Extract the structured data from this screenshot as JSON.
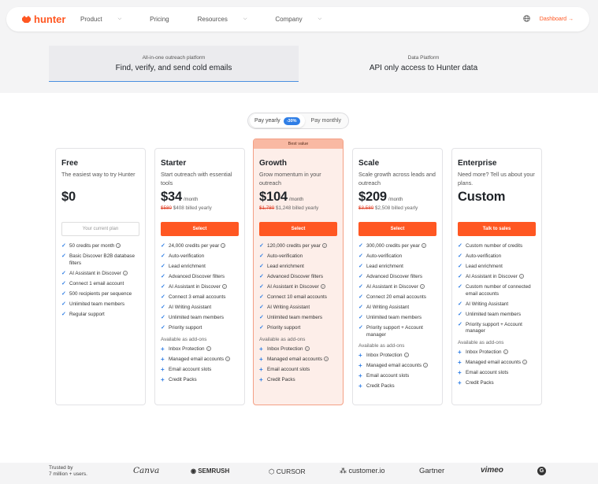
{
  "nav": {
    "brand": "hunter",
    "menu": [
      {
        "label": "Product",
        "chevron": true
      },
      {
        "label": "Pricing",
        "chevron": false
      },
      {
        "label": "Resources",
        "chevron": true
      },
      {
        "label": "Company",
        "chevron": true
      }
    ],
    "dashboard_label": "Dashboard →",
    "icons": [
      "hunter-logo-icon",
      "globe-icon"
    ],
    "accent_color": "#ff5722"
  },
  "tabs": [
    {
      "sub": "All-in-one outreach platform",
      "main": "Find, verify, and send cold emails",
      "active": true
    },
    {
      "sub": "Data Platform",
      "main": "API only access to Hunter data",
      "active": false
    }
  ],
  "billing_toggle": {
    "yearly_label": "Pay yearly",
    "discount_badge": "-30%",
    "monthly_label": "Pay monthly",
    "selected": "yearly",
    "badge_color": "#2f7ee6"
  },
  "plans": [
    {
      "name": "Free",
      "desc": "The easiest way to try Hunter",
      "price": "$0",
      "per": "",
      "old_price": "",
      "billed": "",
      "button": "Your current plan",
      "button_style": "ghost",
      "features": [
        {
          "text": "50 credits per month",
          "info": true
        },
        {
          "text": "Basic Discover B2B database filters",
          "info": false
        },
        {
          "text": "AI Assistant in Discover",
          "info": true
        },
        {
          "text": "Connect 1 email account",
          "info": false
        },
        {
          "text": "500 recipients per sequence",
          "info": false
        },
        {
          "text": "Unlimited team members",
          "info": false
        },
        {
          "text": "Regular support",
          "info": false
        }
      ],
      "addons_heading": "",
      "addons": []
    },
    {
      "name": "Starter",
      "desc": "Start outreach with essential tools",
      "price": "$34",
      "per": "/month",
      "old_price": "$580",
      "billed": "$408 billed yearly",
      "button": "Select",
      "button_style": "primary",
      "features": [
        {
          "text": "24,000 credits per year",
          "info": true
        },
        {
          "text": "Auto-verification",
          "info": false
        },
        {
          "text": "Lead enrichment",
          "info": false
        },
        {
          "text": "Advanced Discover filters",
          "info": false
        },
        {
          "text": "AI Assistant in Discover",
          "info": true
        },
        {
          "text": "Connect 3 email accounts",
          "info": false
        },
        {
          "text": "AI Writing Assistant",
          "info": false
        },
        {
          "text": "Unlimited team members",
          "info": false
        },
        {
          "text": "Priority support",
          "info": false
        }
      ],
      "addons_heading": "Available as add-ons",
      "addons": [
        {
          "text": "Inbox Protection",
          "info": true
        },
        {
          "text": "Managed email accounts",
          "info": true
        },
        {
          "text": "Email account slots",
          "info": false
        },
        {
          "text": "Credit Packs",
          "info": false
        }
      ]
    },
    {
      "name": "Growth",
      "highlight": "Best value",
      "desc": "Grow momentum in your outreach",
      "price": "$104",
      "per": "/month",
      "old_price": "$1,780",
      "billed": "$1,248 billed yearly",
      "button": "Select",
      "button_style": "primary",
      "features": [
        {
          "text": "120,000 credits per year",
          "info": true
        },
        {
          "text": "Auto-verification",
          "info": false
        },
        {
          "text": "Lead enrichment",
          "info": false
        },
        {
          "text": "Advanced Discover filters",
          "info": false
        },
        {
          "text": "AI Assistant in Discover",
          "info": true
        },
        {
          "text": "Connect 10 email accounts",
          "info": false
        },
        {
          "text": "AI Writing Assistant",
          "info": false
        },
        {
          "text": "Unlimited team members",
          "info": false
        },
        {
          "text": "Priority support",
          "info": false
        }
      ],
      "addons_heading": "Available as add-ons",
      "addons": [
        {
          "text": "Inbox Protection",
          "info": true
        },
        {
          "text": "Managed email accounts",
          "info": true
        },
        {
          "text": "Email account slots",
          "info": false
        },
        {
          "text": "Credit Packs",
          "info": false
        }
      ]
    },
    {
      "name": "Scale",
      "desc": "Scale growth across leads and outreach",
      "price": "$209",
      "per": "/month",
      "old_price": "$3,580",
      "billed": "$2,508 billed yearly",
      "button": "Select",
      "button_style": "primary",
      "features": [
        {
          "text": "300,000 credits per year",
          "info": true
        },
        {
          "text": "Auto-verification",
          "info": false
        },
        {
          "text": "Lead enrichment",
          "info": false
        },
        {
          "text": "Advanced Discover filters",
          "info": false
        },
        {
          "text": "AI Assistant in Discover",
          "info": true
        },
        {
          "text": "Connect 20 email accounts",
          "info": false
        },
        {
          "text": "AI Writing Assistant",
          "info": false
        },
        {
          "text": "Unlimited team members",
          "info": false
        },
        {
          "text": "Priority support + Account manager",
          "info": false
        }
      ],
      "addons_heading": "Available as add-ons",
      "addons": [
        {
          "text": "Inbox Protection",
          "info": true
        },
        {
          "text": "Managed email accounts",
          "info": true
        },
        {
          "text": "Email account slots",
          "info": false
        },
        {
          "text": "Credit Packs",
          "info": false
        }
      ]
    },
    {
      "name": "Enterprise",
      "desc": "Need more? Tell us about your plans.",
      "price": "Custom",
      "per": "",
      "old_price": "",
      "billed": "",
      "button": "Talk to sales",
      "button_style": "primary",
      "features": [
        {
          "text": "Custom number of credits",
          "info": false
        },
        {
          "text": "Auto-verification",
          "info": false
        },
        {
          "text": "Lead enrichment",
          "info": false
        },
        {
          "text": "AI Assistant in Discover",
          "info": true
        },
        {
          "text": "Custom number of connected email accounts",
          "info": false
        },
        {
          "text": "AI Writing Assistant",
          "info": false
        },
        {
          "text": "Unlimited team members",
          "info": false
        },
        {
          "text": "Priority support + Account manager",
          "info": false
        }
      ],
      "addons_heading": "Available as add-ons",
      "addons": [
        {
          "text": "Inbox Protection",
          "info": true
        },
        {
          "text": "Managed email accounts",
          "info": true
        },
        {
          "text": "Email account slots",
          "info": false
        },
        {
          "text": "Credit Packs",
          "info": false
        }
      ]
    }
  ],
  "trusted": {
    "line1": "Trusted by",
    "line2": "7 million + users.",
    "logos": [
      "Canva",
      "SEMRUSH",
      "CURSOR",
      "customer.io",
      "Gartner",
      "vimeo",
      "G"
    ]
  }
}
